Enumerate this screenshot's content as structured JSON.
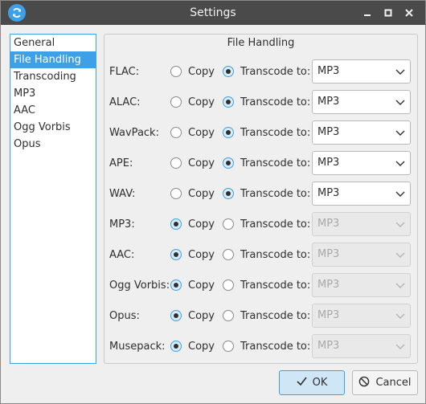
{
  "window": {
    "title": "Settings"
  },
  "sidebar": {
    "items": [
      {
        "label": "General"
      },
      {
        "label": "File Handling",
        "active": true
      },
      {
        "label": "Transcoding"
      },
      {
        "label": "MP3"
      },
      {
        "label": "AAC"
      },
      {
        "label": "Ogg Vorbis"
      },
      {
        "label": "Opus"
      }
    ]
  },
  "panel": {
    "title": "File Handling",
    "copy_label": "Copy",
    "transcode_label": "Transcode to:",
    "rows": [
      {
        "format": "FLAC:",
        "mode": "transcode",
        "target": "MP3"
      },
      {
        "format": "ALAC:",
        "mode": "transcode",
        "target": "MP3"
      },
      {
        "format": "WavPack:",
        "mode": "transcode",
        "target": "MP3"
      },
      {
        "format": "APE:",
        "mode": "transcode",
        "target": "MP3"
      },
      {
        "format": "WAV:",
        "mode": "transcode",
        "target": "MP3"
      },
      {
        "format": "MP3:",
        "mode": "copy",
        "target": "MP3"
      },
      {
        "format": "AAC:",
        "mode": "copy",
        "target": "MP3"
      },
      {
        "format": "Ogg Vorbis:",
        "mode": "copy",
        "target": "MP3"
      },
      {
        "format": "Opus:",
        "mode": "copy",
        "target": "MP3"
      },
      {
        "format": "Musepack:",
        "mode": "copy",
        "target": "MP3"
      }
    ]
  },
  "buttons": {
    "ok": "OK",
    "cancel": "Cancel"
  },
  "colors": {
    "accent": "#3ea0e6",
    "titlebar": "#4a4a4a"
  }
}
